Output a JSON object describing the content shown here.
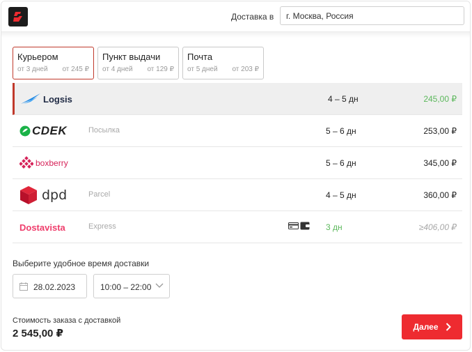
{
  "header": {
    "logo_icon": "brand-s-logo",
    "delivery_label": "Доставка в",
    "city_value": "г. Москва, Россия"
  },
  "tabs": [
    {
      "title": "Курьером",
      "time": "от 3 дней",
      "price": "от 245 ₽",
      "active": true
    },
    {
      "title": "Пункт выдачи",
      "time": "от 4 дней",
      "price": "от 129 ₽",
      "active": false
    },
    {
      "title": "Почта",
      "time": "от 5 дней",
      "price": "от 203 ₽",
      "active": false
    }
  ],
  "carriers": [
    {
      "name": "Logsis",
      "service": "",
      "days": "4 – 5 дн",
      "price": "245,00 ₽",
      "selected": true
    },
    {
      "name": "CDEK",
      "service": "Посылка",
      "days": "5 – 6 дн",
      "price": "253,00 ₽",
      "selected": false
    },
    {
      "name": "boxberry",
      "service": "",
      "days": "5 – 6 дн",
      "price": "345,00 ₽",
      "selected": false
    },
    {
      "name": "dpd",
      "service": "Parcel",
      "days": "4 – 5 дн",
      "price": "360,00 ₽",
      "selected": false
    },
    {
      "name": "Dostavista",
      "service": "Express",
      "days": "3 дн",
      "price": "≥406,00 ₽",
      "selected": false,
      "payment_icons": [
        "card-icon",
        "wallet-icon"
      ]
    }
  ],
  "time_section": {
    "title": "Выберите удобное время доставки",
    "date_value": "28.02.2023",
    "time_value": "10:00 – 22:00"
  },
  "footer": {
    "total_label": "Стоимость заказа с доставкой",
    "total_value": "2 545,00 ₽",
    "next_label": "Далее"
  },
  "colors": {
    "accent_red": "#ee2b30",
    "selected_border": "#c0392b",
    "green": "#5cb85c",
    "muted": "#a8a8a8"
  }
}
